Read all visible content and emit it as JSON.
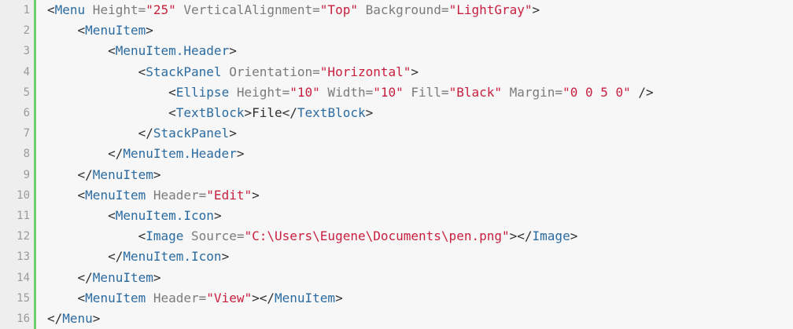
{
  "colors": {
    "background": "#f7f7f7",
    "gutter": "#eeeeee",
    "gutter_border": "#6ccf6c",
    "tag": "#2b6ba0",
    "attribute": "#7b7b7b",
    "value": "#c81f3f",
    "text": "#303030"
  },
  "code": {
    "lines": [
      {
        "num": "1",
        "indent": 0,
        "tokens": [
          [
            "punc",
            "<"
          ],
          [
            "tag",
            "Menu"
          ],
          [
            "attr",
            " Height="
          ],
          [
            "val",
            "\"25\""
          ],
          [
            "attr",
            " VerticalAlignment="
          ],
          [
            "val",
            "\"Top\""
          ],
          [
            "attr",
            " Background="
          ],
          [
            "val",
            "\"LightGray\""
          ],
          [
            "punc",
            ">"
          ]
        ]
      },
      {
        "num": "2",
        "indent": 4,
        "tokens": [
          [
            "punc",
            "<"
          ],
          [
            "tag",
            "MenuItem"
          ],
          [
            "punc",
            ">"
          ]
        ]
      },
      {
        "num": "3",
        "indent": 8,
        "tokens": [
          [
            "punc",
            "<"
          ],
          [
            "tag",
            "MenuItem.Header"
          ],
          [
            "punc",
            ">"
          ]
        ]
      },
      {
        "num": "4",
        "indent": 12,
        "tokens": [
          [
            "punc",
            "<"
          ],
          [
            "tag",
            "StackPanel"
          ],
          [
            "attr",
            " Orientation="
          ],
          [
            "val",
            "\"Horizontal\""
          ],
          [
            "punc",
            ">"
          ]
        ]
      },
      {
        "num": "5",
        "indent": 16,
        "tokens": [
          [
            "punc",
            "<"
          ],
          [
            "tag",
            "Ellipse"
          ],
          [
            "attr",
            " Height="
          ],
          [
            "val",
            "\"10\""
          ],
          [
            "attr",
            " Width="
          ],
          [
            "val",
            "\"10\""
          ],
          [
            "attr",
            " Fill="
          ],
          [
            "val",
            "\"Black\""
          ],
          [
            "attr",
            " Margin="
          ],
          [
            "val",
            "\"0 0 5 0\""
          ],
          [
            "punc",
            " />"
          ]
        ]
      },
      {
        "num": "6",
        "indent": 16,
        "tokens": [
          [
            "punc",
            "<"
          ],
          [
            "tag",
            "TextBlock"
          ],
          [
            "punc",
            ">"
          ],
          [
            "txt",
            "File"
          ],
          [
            "punc",
            "</"
          ],
          [
            "tag",
            "TextBlock"
          ],
          [
            "punc",
            ">"
          ]
        ]
      },
      {
        "num": "7",
        "indent": 12,
        "tokens": [
          [
            "punc",
            "</"
          ],
          [
            "tag",
            "StackPanel"
          ],
          [
            "punc",
            ">"
          ]
        ]
      },
      {
        "num": "8",
        "indent": 8,
        "tokens": [
          [
            "punc",
            "</"
          ],
          [
            "tag",
            "MenuItem.Header"
          ],
          [
            "punc",
            ">"
          ]
        ]
      },
      {
        "num": "9",
        "indent": 4,
        "tokens": [
          [
            "punc",
            "</"
          ],
          [
            "tag",
            "MenuItem"
          ],
          [
            "punc",
            ">"
          ]
        ]
      },
      {
        "num": "10",
        "indent": 4,
        "tokens": [
          [
            "punc",
            "<"
          ],
          [
            "tag",
            "MenuItem"
          ],
          [
            "attr",
            " Header="
          ],
          [
            "val",
            "\"Edit\""
          ],
          [
            "punc",
            ">"
          ]
        ]
      },
      {
        "num": "11",
        "indent": 8,
        "tokens": [
          [
            "punc",
            "<"
          ],
          [
            "tag",
            "MenuItem.Icon"
          ],
          [
            "punc",
            ">"
          ]
        ]
      },
      {
        "num": "12",
        "indent": 12,
        "tokens": [
          [
            "punc",
            "<"
          ],
          [
            "tag",
            "Image"
          ],
          [
            "attr",
            " Source="
          ],
          [
            "val",
            "\"C:\\Users\\Eugene\\Documents\\pen.png\""
          ],
          [
            "punc",
            "></"
          ],
          [
            "tag",
            "Image"
          ],
          [
            "punc",
            ">"
          ]
        ]
      },
      {
        "num": "13",
        "indent": 8,
        "tokens": [
          [
            "punc",
            "</"
          ],
          [
            "tag",
            "MenuItem.Icon"
          ],
          [
            "punc",
            ">"
          ]
        ]
      },
      {
        "num": "14",
        "indent": 4,
        "tokens": [
          [
            "punc",
            "</"
          ],
          [
            "tag",
            "MenuItem"
          ],
          [
            "punc",
            ">"
          ]
        ]
      },
      {
        "num": "15",
        "indent": 4,
        "tokens": [
          [
            "punc",
            "<"
          ],
          [
            "tag",
            "MenuItem"
          ],
          [
            "attr",
            " Header="
          ],
          [
            "val",
            "\"View\""
          ],
          [
            "punc",
            "></"
          ],
          [
            "tag",
            "MenuItem"
          ],
          [
            "punc",
            ">"
          ]
        ]
      },
      {
        "num": "16",
        "indent": 0,
        "tokens": [
          [
            "punc",
            "</"
          ],
          [
            "tag",
            "Menu"
          ],
          [
            "punc",
            ">"
          ]
        ]
      }
    ]
  }
}
